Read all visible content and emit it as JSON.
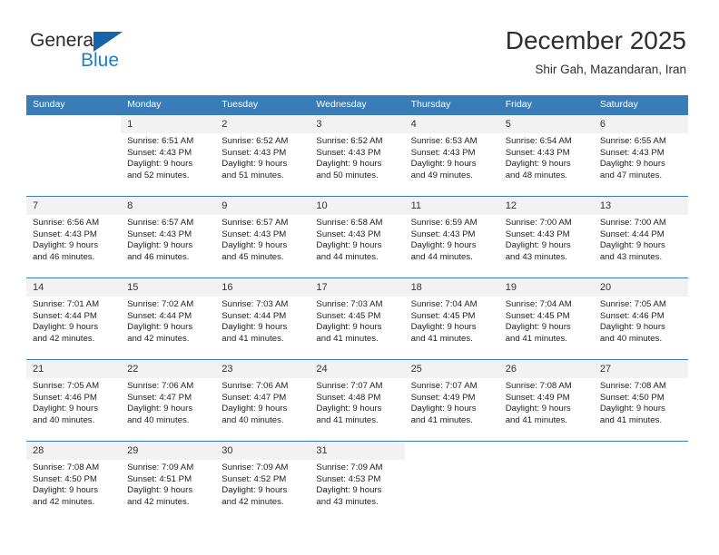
{
  "brand": {
    "general": "General",
    "blue": "Blue",
    "logo_icon": "triangle-logo-icon"
  },
  "header": {
    "title": "December 2025",
    "subtitle": "Shir Gah, Mazandaran, Iran"
  },
  "colors": {
    "header_blue": "#3a7cb8",
    "brand_blue": "#1f7fc4",
    "daynum_bg": "#f2f2f2",
    "text": "#222222"
  },
  "weekdays": [
    "Sunday",
    "Monday",
    "Tuesday",
    "Wednesday",
    "Thursday",
    "Friday",
    "Saturday"
  ],
  "weeks": [
    [
      {
        "day": "",
        "blank": true,
        "sunrise": "",
        "sunset": "",
        "daylight1": "",
        "daylight2": ""
      },
      {
        "day": "1",
        "sunrise": "Sunrise: 6:51 AM",
        "sunset": "Sunset: 4:43 PM",
        "daylight1": "Daylight: 9 hours",
        "daylight2": "and 52 minutes."
      },
      {
        "day": "2",
        "sunrise": "Sunrise: 6:52 AM",
        "sunset": "Sunset: 4:43 PM",
        "daylight1": "Daylight: 9 hours",
        "daylight2": "and 51 minutes."
      },
      {
        "day": "3",
        "sunrise": "Sunrise: 6:52 AM",
        "sunset": "Sunset: 4:43 PM",
        "daylight1": "Daylight: 9 hours",
        "daylight2": "and 50 minutes."
      },
      {
        "day": "4",
        "sunrise": "Sunrise: 6:53 AM",
        "sunset": "Sunset: 4:43 PM",
        "daylight1": "Daylight: 9 hours",
        "daylight2": "and 49 minutes."
      },
      {
        "day": "5",
        "sunrise": "Sunrise: 6:54 AM",
        "sunset": "Sunset: 4:43 PM",
        "daylight1": "Daylight: 9 hours",
        "daylight2": "and 48 minutes."
      },
      {
        "day": "6",
        "sunrise": "Sunrise: 6:55 AM",
        "sunset": "Sunset: 4:43 PM",
        "daylight1": "Daylight: 9 hours",
        "daylight2": "and 47 minutes."
      }
    ],
    [
      {
        "day": "7",
        "sunrise": "Sunrise: 6:56 AM",
        "sunset": "Sunset: 4:43 PM",
        "daylight1": "Daylight: 9 hours",
        "daylight2": "and 46 minutes."
      },
      {
        "day": "8",
        "sunrise": "Sunrise: 6:57 AM",
        "sunset": "Sunset: 4:43 PM",
        "daylight1": "Daylight: 9 hours",
        "daylight2": "and 46 minutes."
      },
      {
        "day": "9",
        "sunrise": "Sunrise: 6:57 AM",
        "sunset": "Sunset: 4:43 PM",
        "daylight1": "Daylight: 9 hours",
        "daylight2": "and 45 minutes."
      },
      {
        "day": "10",
        "sunrise": "Sunrise: 6:58 AM",
        "sunset": "Sunset: 4:43 PM",
        "daylight1": "Daylight: 9 hours",
        "daylight2": "and 44 minutes."
      },
      {
        "day": "11",
        "sunrise": "Sunrise: 6:59 AM",
        "sunset": "Sunset: 4:43 PM",
        "daylight1": "Daylight: 9 hours",
        "daylight2": "and 44 minutes."
      },
      {
        "day": "12",
        "sunrise": "Sunrise: 7:00 AM",
        "sunset": "Sunset: 4:43 PM",
        "daylight1": "Daylight: 9 hours",
        "daylight2": "and 43 minutes."
      },
      {
        "day": "13",
        "sunrise": "Sunrise: 7:00 AM",
        "sunset": "Sunset: 4:44 PM",
        "daylight1": "Daylight: 9 hours",
        "daylight2": "and 43 minutes."
      }
    ],
    [
      {
        "day": "14",
        "sunrise": "Sunrise: 7:01 AM",
        "sunset": "Sunset: 4:44 PM",
        "daylight1": "Daylight: 9 hours",
        "daylight2": "and 42 minutes."
      },
      {
        "day": "15",
        "sunrise": "Sunrise: 7:02 AM",
        "sunset": "Sunset: 4:44 PM",
        "daylight1": "Daylight: 9 hours",
        "daylight2": "and 42 minutes."
      },
      {
        "day": "16",
        "sunrise": "Sunrise: 7:03 AM",
        "sunset": "Sunset: 4:44 PM",
        "daylight1": "Daylight: 9 hours",
        "daylight2": "and 41 minutes."
      },
      {
        "day": "17",
        "sunrise": "Sunrise: 7:03 AM",
        "sunset": "Sunset: 4:45 PM",
        "daylight1": "Daylight: 9 hours",
        "daylight2": "and 41 minutes."
      },
      {
        "day": "18",
        "sunrise": "Sunrise: 7:04 AM",
        "sunset": "Sunset: 4:45 PM",
        "daylight1": "Daylight: 9 hours",
        "daylight2": "and 41 minutes."
      },
      {
        "day": "19",
        "sunrise": "Sunrise: 7:04 AM",
        "sunset": "Sunset: 4:45 PM",
        "daylight1": "Daylight: 9 hours",
        "daylight2": "and 41 minutes."
      },
      {
        "day": "20",
        "sunrise": "Sunrise: 7:05 AM",
        "sunset": "Sunset: 4:46 PM",
        "daylight1": "Daylight: 9 hours",
        "daylight2": "and 40 minutes."
      }
    ],
    [
      {
        "day": "21",
        "sunrise": "Sunrise: 7:05 AM",
        "sunset": "Sunset: 4:46 PM",
        "daylight1": "Daylight: 9 hours",
        "daylight2": "and 40 minutes."
      },
      {
        "day": "22",
        "sunrise": "Sunrise: 7:06 AM",
        "sunset": "Sunset: 4:47 PM",
        "daylight1": "Daylight: 9 hours",
        "daylight2": "and 40 minutes."
      },
      {
        "day": "23",
        "sunrise": "Sunrise: 7:06 AM",
        "sunset": "Sunset: 4:47 PM",
        "daylight1": "Daylight: 9 hours",
        "daylight2": "and 40 minutes."
      },
      {
        "day": "24",
        "sunrise": "Sunrise: 7:07 AM",
        "sunset": "Sunset: 4:48 PM",
        "daylight1": "Daylight: 9 hours",
        "daylight2": "and 41 minutes."
      },
      {
        "day": "25",
        "sunrise": "Sunrise: 7:07 AM",
        "sunset": "Sunset: 4:49 PM",
        "daylight1": "Daylight: 9 hours",
        "daylight2": "and 41 minutes."
      },
      {
        "day": "26",
        "sunrise": "Sunrise: 7:08 AM",
        "sunset": "Sunset: 4:49 PM",
        "daylight1": "Daylight: 9 hours",
        "daylight2": "and 41 minutes."
      },
      {
        "day": "27",
        "sunrise": "Sunrise: 7:08 AM",
        "sunset": "Sunset: 4:50 PM",
        "daylight1": "Daylight: 9 hours",
        "daylight2": "and 41 minutes."
      }
    ],
    [
      {
        "day": "28",
        "sunrise": "Sunrise: 7:08 AM",
        "sunset": "Sunset: 4:50 PM",
        "daylight1": "Daylight: 9 hours",
        "daylight2": "and 42 minutes."
      },
      {
        "day": "29",
        "sunrise": "Sunrise: 7:09 AM",
        "sunset": "Sunset: 4:51 PM",
        "daylight1": "Daylight: 9 hours",
        "daylight2": "and 42 minutes."
      },
      {
        "day": "30",
        "sunrise": "Sunrise: 7:09 AM",
        "sunset": "Sunset: 4:52 PM",
        "daylight1": "Daylight: 9 hours",
        "daylight2": "and 42 minutes."
      },
      {
        "day": "31",
        "sunrise": "Sunrise: 7:09 AM",
        "sunset": "Sunset: 4:53 PM",
        "daylight1": "Daylight: 9 hours",
        "daylight2": "and 43 minutes."
      },
      {
        "day": "",
        "blank": true,
        "sunrise": "",
        "sunset": "",
        "daylight1": "",
        "daylight2": ""
      },
      {
        "day": "",
        "blank": true,
        "sunrise": "",
        "sunset": "",
        "daylight1": "",
        "daylight2": ""
      },
      {
        "day": "",
        "blank": true,
        "sunrise": "",
        "sunset": "",
        "daylight1": "",
        "daylight2": ""
      }
    ]
  ]
}
